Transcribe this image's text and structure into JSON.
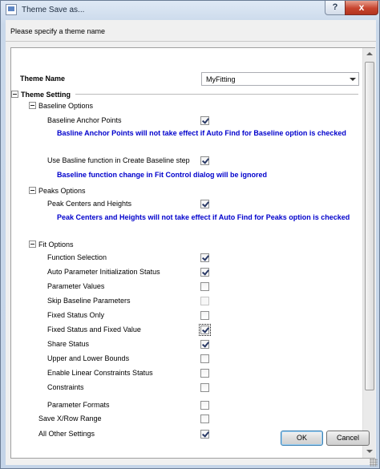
{
  "window": {
    "title": "Theme Save as...",
    "help_label": "?",
    "close_label": "x"
  },
  "prompt": "Please specify a theme name",
  "theme_name": {
    "label": "Theme Name",
    "value": "MyFitting"
  },
  "theme_setting": {
    "label": "Theme Setting",
    "baseline": {
      "label": "Baseline Options",
      "anchor_points": {
        "label": "Baseline Anchor Points",
        "checked": true
      },
      "anchor_warning": "Basline Anchor Points will not take effect if Auto Find for Baseline option is checked",
      "use_function": {
        "label": "Use Basline function in Create Baseline step",
        "checked": true
      },
      "function_warning": "Baseline function change in Fit Control dialog will be ignored"
    },
    "peaks": {
      "label": "Peaks Options",
      "centers_heights": {
        "label": "Peak Centers and Heights",
        "checked": true
      },
      "centers_warning": "Peak Centers and Heights will not take effect if Auto Find for Peaks option is checked"
    },
    "fit": {
      "label": "Fit Options",
      "items": [
        {
          "label": "Function Selection",
          "checked": true
        },
        {
          "label": "Auto Parameter Initialization Status",
          "checked": true
        },
        {
          "label": "Parameter Values",
          "checked": false
        },
        {
          "label": "Skip Baseline Parameters",
          "checked": false
        },
        {
          "label": "Fixed Status Only",
          "checked": false
        },
        {
          "label": "Fixed Status and Fixed Value",
          "checked": true
        },
        {
          "label": "Share Status",
          "checked": true
        },
        {
          "label": "Upper and Lower Bounds",
          "checked": false
        },
        {
          "label": "Enable Linear Constraints Status",
          "checked": false
        },
        {
          "label": "Constraints",
          "checked": false
        },
        {
          "label": "Parameter Formats",
          "checked": false
        }
      ]
    },
    "save_xrow": {
      "label": "Save X/Row Range",
      "checked": false
    },
    "all_other": {
      "label": "All Other Settings",
      "checked": true
    }
  },
  "buttons": {
    "ok": "OK",
    "cancel": "Cancel"
  }
}
